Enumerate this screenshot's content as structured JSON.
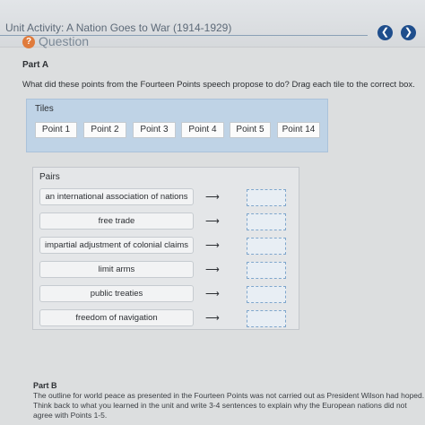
{
  "header": {
    "unit_title": "Unit Activity: A Nation Goes to War (1914-1929)",
    "question_label": "Question",
    "question_icon": "question-icon",
    "prev_icon": "chevron-left-icon",
    "next_icon": "chevron-right-icon"
  },
  "part_a": {
    "label": "Part A",
    "prompt": "What did these points from the Fourteen Points speech propose to do? Drag each tile to the correct box."
  },
  "tiles": {
    "label": "Tiles",
    "items": [
      "Point 1",
      "Point 2",
      "Point 3",
      "Point 4",
      "Point 5",
      "Point 14"
    ]
  },
  "pairs": {
    "label": "Pairs",
    "items": [
      "an international association of nations",
      "free trade",
      "impartial adjustment of colonial claims",
      "limit arms",
      "public treaties",
      "freedom of navigation"
    ],
    "arrow": "⟶"
  },
  "part_b": {
    "label": "Part B",
    "text": "The outline for world peace as presented in the Fourteen Points was not carried out as President Wilson had hoped. Think back to what you learned in the unit and write 3-4 sentences to explain why the European nations did not agree with Points 1-5."
  },
  "colors": {
    "accent": "#1f4e8c",
    "tiles_bg": "#bfd3e6",
    "question_icon": "#e07b3c",
    "dropzone_border": "#7fa6cc"
  }
}
